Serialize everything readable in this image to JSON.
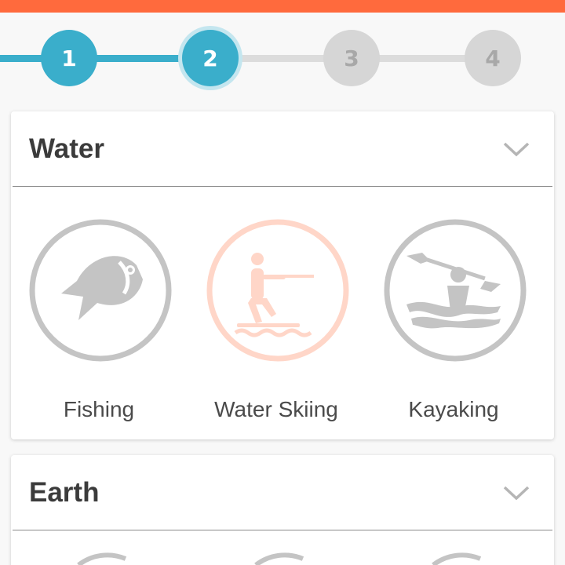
{
  "colors": {
    "accent_bar": "#ff6a3d",
    "step_active": "#3aaecb",
    "step_pending": "#d6d6d6",
    "icon_gray": "#c4c4c4",
    "icon_selected_tint": "#ffd6c8"
  },
  "stepper": {
    "current_step": 2,
    "steps": [
      {
        "label": "1",
        "state": "done"
      },
      {
        "label": "2",
        "state": "current"
      },
      {
        "label": "3",
        "state": "pending"
      },
      {
        "label": "4",
        "state": "pending"
      }
    ]
  },
  "categories": [
    {
      "title": "Water",
      "icon": "chevron-down-icon",
      "activities": [
        {
          "label": "Fishing",
          "icon": "fish-icon",
          "selected": false
        },
        {
          "label": "Water Skiing",
          "icon": "water-skier-icon",
          "selected": true
        },
        {
          "label": "Kayaking",
          "icon": "kayaker-icon",
          "selected": false
        }
      ]
    },
    {
      "title": "Earth",
      "icon": "chevron-down-icon"
    }
  ]
}
